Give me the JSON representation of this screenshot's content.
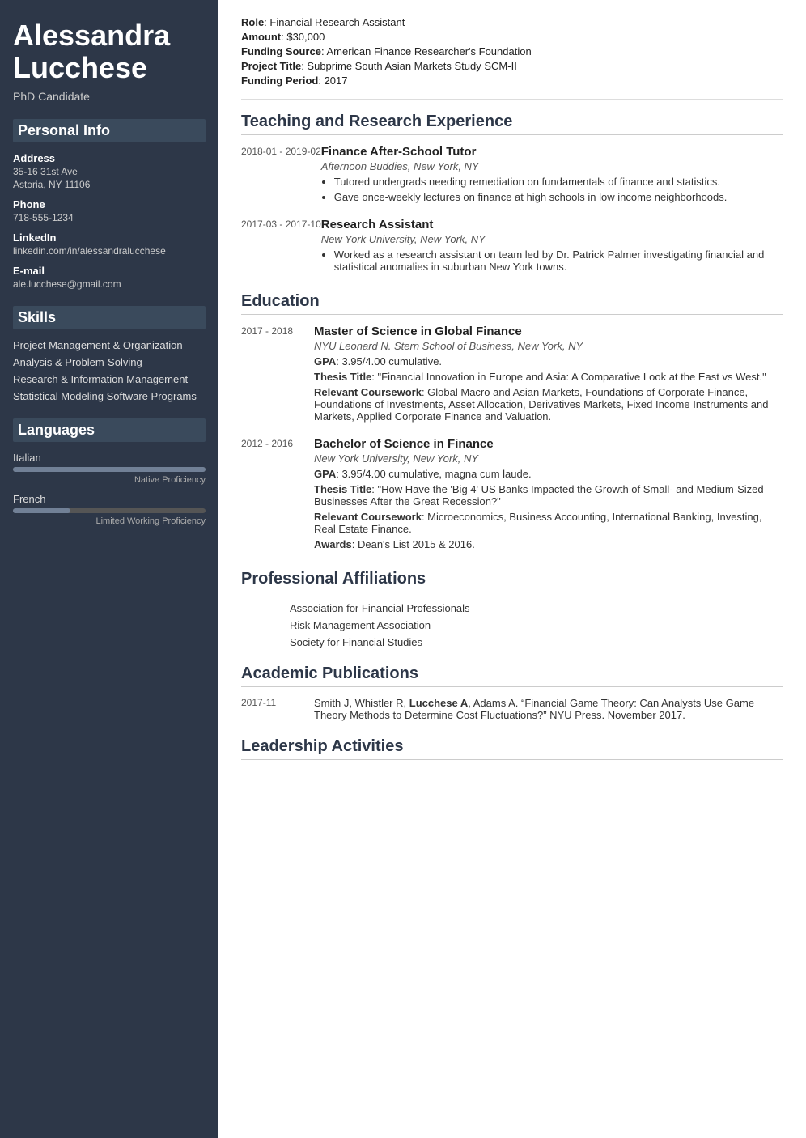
{
  "sidebar": {
    "name": "Alessandra Lucchese",
    "title": "PhD Candidate",
    "personal_info_title": "Personal Info",
    "address_label": "Address",
    "address_line1": "35-16 31st Ave",
    "address_line2": "Astoria, NY 11106",
    "phone_label": "Phone",
    "phone": "718-555-1234",
    "linkedin_label": "LinkedIn",
    "linkedin": "linkedin.com/in/alessandralucchese",
    "email_label": "E-mail",
    "email": "ale.lucchese@gmail.com",
    "skills_title": "Skills",
    "skills": [
      "Project Management & Organization",
      "Analysis & Problem-Solving",
      "Research & Information Management",
      "Statistical Modeling Software Programs"
    ],
    "languages_title": "Languages",
    "languages": [
      {
        "name": "Italian",
        "level": "Native Proficiency",
        "percent": 100
      },
      {
        "name": "French",
        "level": "Limited Working Proficiency",
        "percent": 30
      }
    ]
  },
  "main": {
    "role_label": "Role",
    "role_value": "Financial Research Assistant",
    "amount_label": "Amount",
    "amount_value": "$30,000",
    "funding_source_label": "Funding Source",
    "funding_source_value": "American Finance Researcher's Foundation",
    "project_title_label": "Project Title",
    "project_title_value": "Subprime South Asian Markets Study SCM-II",
    "funding_period_label": "Funding Period",
    "funding_period_value": "2017",
    "teaching_section_title": "Teaching and Research Experience",
    "teaching_entries": [
      {
        "date": "2018-01 - 2019-02",
        "title": "Finance After-School Tutor",
        "institution": "Afternoon Buddies, New York, NY",
        "bullets": [
          "Tutored undergrads needing remediation on fundamentals of finance and statistics.",
          "Gave once-weekly lectures on finance at high schools in low income neighborhoods."
        ]
      },
      {
        "date": "2017-03 - 2017-10",
        "title": "Research Assistant",
        "institution": "New York University, New York, NY",
        "bullets": [
          "Worked as a research assistant on team led by Dr. Patrick Palmer investigating financial and statistical anomalies in suburban New York towns."
        ]
      }
    ],
    "education_section_title": "Education",
    "education_entries": [
      {
        "date": "2017 - 2018",
        "title": "Master of Science in Global Finance",
        "institution": "NYU Leonard N. Stern School of Business, New York, NY",
        "gpa": "3.95/4.00 cumulative.",
        "thesis_title": "\"Financial Innovation in Europe and Asia: A Comparative Look at the East vs West.\"",
        "coursework": "Global Macro and Asian Markets, Foundations of Corporate Finance, Foundations of Investments, Asset Allocation, Derivatives Markets, Fixed Income Instruments and Markets, Applied Corporate Finance and Valuation."
      },
      {
        "date": "2012 - 2016",
        "title": "Bachelor of Science in Finance",
        "institution": "New York University, New York, NY",
        "gpa": "3.95/4.00 cumulative, magna cum laude.",
        "thesis_title": "\"How Have the 'Big 4' US Banks Impacted the Growth of Small- and Medium-Sized Businesses After the Great Recession?\"",
        "coursework": "Microeconomics, Business Accounting, International Banking, Investing, Real Estate Finance.",
        "awards": "Dean's List 2015 & 2016."
      }
    ],
    "affiliations_section_title": "Professional Affiliations",
    "affiliations": [
      "Association for Financial Professionals",
      "Risk Management Association",
      "Society for Financial Studies"
    ],
    "publications_section_title": "Academic Publications",
    "publications": [
      {
        "date": "2017-11",
        "text_before": "Smith J, Whistler R, ",
        "author_bold": "Lucchese A",
        "text_after": ", Adams A. “Financial Game Theory: Can Analysts Use Game Theory Methods to Determine Cost Fluctuations?” NYU Press. November 2017."
      }
    ],
    "leadership_section_title": "Leadership Activities"
  }
}
